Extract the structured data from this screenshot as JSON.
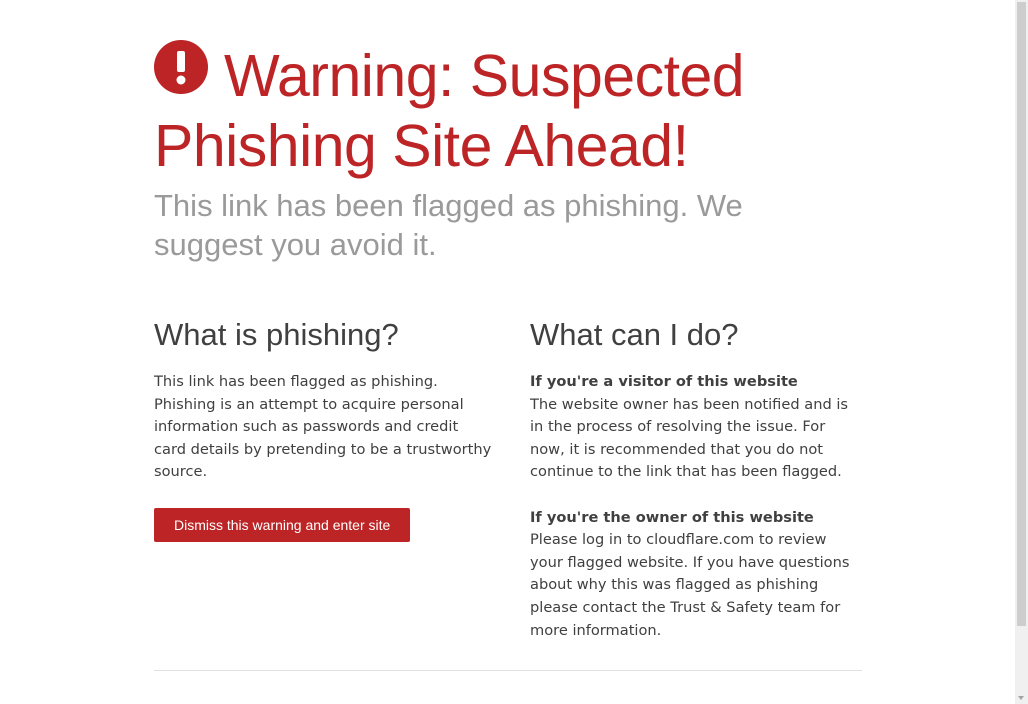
{
  "header": {
    "title": "Warning: Suspected Phishing Site Ahead!",
    "subtitle": "This link has been flagged as phishing. We suggest you avoid it."
  },
  "left_column": {
    "heading": "What is phishing?",
    "body": "This link has been flagged as phishing. Phishing is an attempt to acquire personal information such as passwords and credit card details by pretending to be a trustworthy source.",
    "button_label": "Dismiss this warning and enter site"
  },
  "right_column": {
    "heading": "What can I do?",
    "visitor_heading": "If you're a visitor of this website",
    "visitor_body": "The website owner has been notified and is in the process of resolving the issue. For now, it is recommended that you do not continue to the link that has been flagged.",
    "owner_heading": "If you're the owner of this website",
    "owner_body": "Please log in to cloudflare.com to review your flagged website. If you have questions about why this was flagged as phishing please contact the Trust & Safety team for more information."
  },
  "icons": {
    "warning": "exclamation-circle-icon"
  },
  "colors": {
    "accent": "#bd2426",
    "subtitle": "#9a9a9a",
    "text": "#404041"
  }
}
